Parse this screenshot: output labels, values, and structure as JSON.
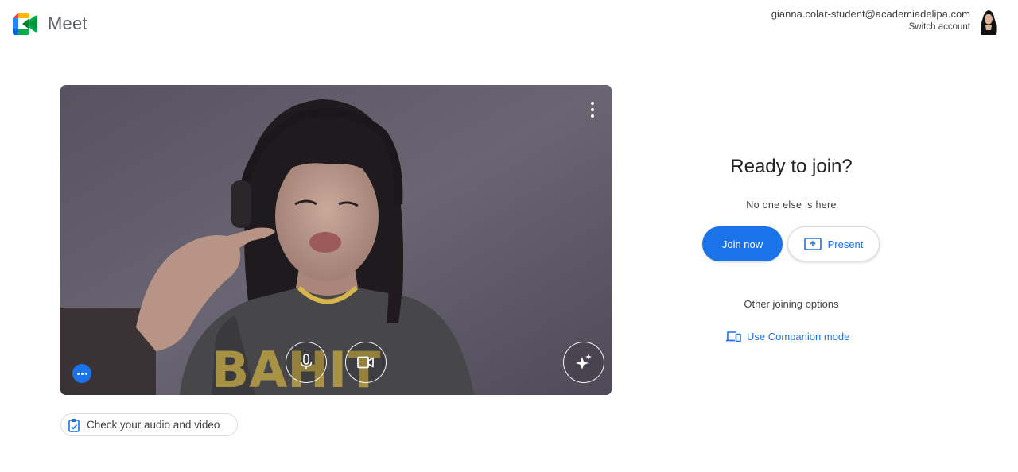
{
  "app": {
    "name": "Meet"
  },
  "account": {
    "email": "gianna.colar-student@academiadelipa.com",
    "switch_label": "Switch account"
  },
  "preview": {
    "check_audio_label": "Check your audio and video"
  },
  "join_panel": {
    "title": "Ready to join?",
    "subtitle": "No one else is here",
    "join_label": "Join now",
    "present_label": "Present",
    "other_options_label": "Other joining options",
    "companion_label": "Use Companion mode"
  },
  "colors": {
    "accent": "#1a73e8",
    "logo_green": "#00832d",
    "logo_blue": "#0066da",
    "logo_red": "#e94235",
    "logo_yellow": "#ffba00",
    "logo_light_green": "#00ac47",
    "logo_light_blue": "#2684fc"
  },
  "icons": {
    "kebab": "more-vert-icon",
    "mic": "microphone-icon",
    "camera": "videocam-icon",
    "effects": "sparkle-effects-icon",
    "more": "more-horiz-icon",
    "check": "clipboard-check-icon",
    "present": "present-to-all-icon",
    "companion": "devices-icon"
  }
}
